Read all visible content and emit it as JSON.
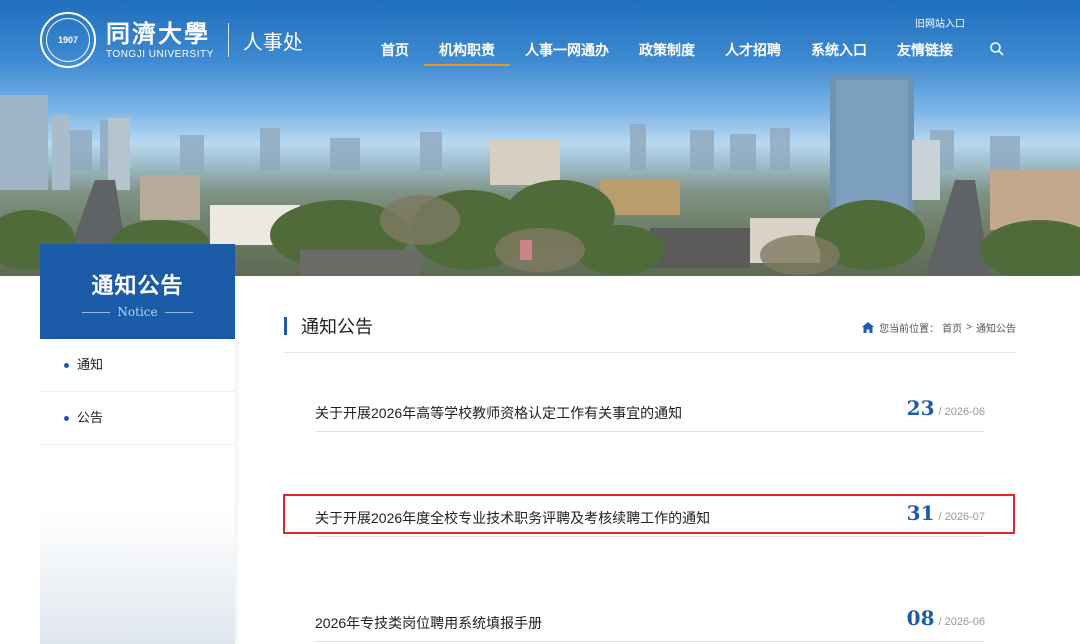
{
  "header": {
    "univ_cn": "同濟大學",
    "univ_en": "TONGJI UNIVERSITY",
    "seal_text": "1907",
    "dept": "人事处",
    "old_site": "旧网站入口"
  },
  "nav": {
    "items": [
      {
        "label": "首页"
      },
      {
        "label": "机构职责"
      },
      {
        "label": "人事一网通办"
      },
      {
        "label": "政策制度"
      },
      {
        "label": "人才招聘"
      },
      {
        "label": "系统入口"
      },
      {
        "label": "友情链接"
      }
    ],
    "active": "机构职责",
    "search_icon": "search-icon"
  },
  "sidebar": {
    "title": "通知公告",
    "subtitle": "Notice",
    "items": [
      {
        "label": "通知"
      },
      {
        "label": "公告"
      }
    ]
  },
  "main": {
    "title": "通知公告",
    "breadcrumb": {
      "prefix": "您当前位置：",
      "home": "首页",
      "sep": ">",
      "current": "通知公告"
    },
    "news": [
      {
        "title": "关于开展2026年高等学校教师资格认定工作有关事宜的通知",
        "day": "23",
        "ym": "/ 2026-06"
      },
      {
        "title": "关于开展2026年度全校专业技术职务评聘及考核续聘工作的通知",
        "day": "31",
        "ym": "/ 2026-07"
      },
      {
        "title": "2026年专技类岗位聘用系统填报手册",
        "day": "08",
        "ym": "/ 2026-06"
      }
    ]
  },
  "colors": {
    "brand_blue": "#1c5ba7",
    "nav_active": "#e39a23",
    "highlight": "#e0262b"
  }
}
